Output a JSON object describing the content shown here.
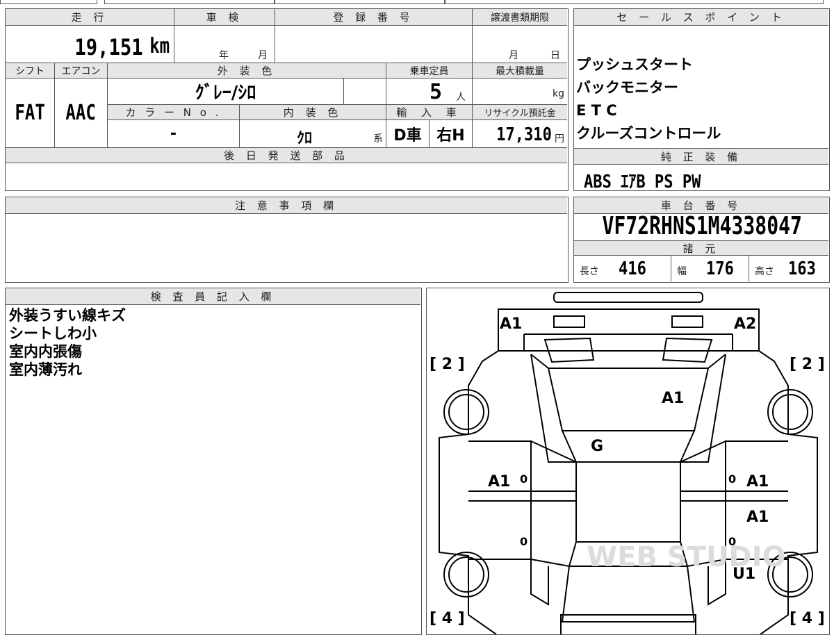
{
  "topTable": {
    "headers": {
      "mileage": "走 行",
      "inspection": "車 検",
      "registration": "登 録 番 号",
      "transferDeadline": "譲渡書類期限",
      "shift": "シフト",
      "aircon": "エアコン",
      "exteriorColor": "外 装 色",
      "capacity": "乗車定員",
      "maxLoad": "最大積載量",
      "colorNo": "カ ラ ー N o .",
      "interiorColor": "内 装 色",
      "imported": "輸 入 車",
      "recycleFee": "リサイクル預託金",
      "laterParts": "後 日 発 送 部 品"
    },
    "values": {
      "mileage": "19,151",
      "mileageUnit": "km",
      "inspectionYear": "年",
      "inspectionMonth": "月",
      "transferMonth": "月",
      "transferDay": "日",
      "shift": "FAT",
      "aircon": "AAC",
      "exteriorColor": "ｸﾞﾚｰ/ｼﾛ",
      "capacity": "5",
      "capacityUnit": "人",
      "loadUnit": "kg",
      "colorNo": "-",
      "interiorColor": "ｸﾛ",
      "interiorSuffix": "系",
      "dealerCar": "D車",
      "steering": "右H",
      "recycleFee": "17,310",
      "recycleUnit": "円"
    }
  },
  "salesPoints": {
    "header": "セ ー ル ス ポ イ ン ト",
    "items": [
      "プッシュスタート",
      "バックモニター",
      "E T C",
      "クルーズコントロール"
    ]
  },
  "equipment": {
    "header": "純 正 装 備",
    "value": "ABS ｴｱB PS PW"
  },
  "notes": {
    "header": "注 意 事 項 欄"
  },
  "chassis": {
    "header": "車 台 番 号",
    "value": "VF72RHNS1M4338047"
  },
  "specs": {
    "header": "諸 元",
    "lengthLabel": "長さ",
    "length": "416",
    "widthLabel": "幅",
    "width": "176",
    "heightLabel": "高さ",
    "height": "163"
  },
  "inspector": {
    "header": "検 査 員 記 入 欄",
    "items": [
      "外装うすい線キズ",
      "シートしわ小",
      "室内内張傷",
      "室内薄汚れ"
    ]
  },
  "diagram": {
    "marks": {
      "frontLeft": "A1",
      "frontRight": "A2",
      "hood": "A1",
      "windshield": "G",
      "leftFrontDoor": "A1",
      "rightFrontDoor": "A1",
      "rightRearDoor": "A1",
      "rightRearFender": "U1",
      "zeroA": "0",
      "zeroB": "0",
      "zeroC": "0",
      "zeroD": "0"
    },
    "tireLabels": {
      "frontLeft": "[ 2 ]",
      "frontRight": "[ 2 ]",
      "rearLeft": "[ 4 ]",
      "rearRight": "[ 4 ]"
    },
    "watermark": "WEB STUDIO"
  }
}
